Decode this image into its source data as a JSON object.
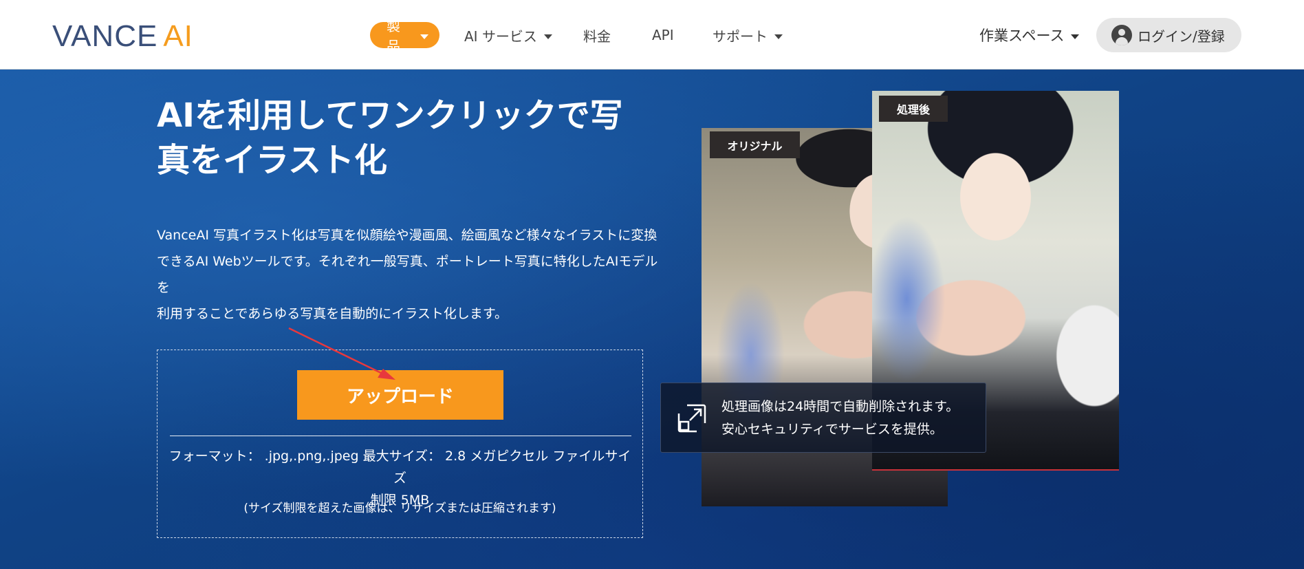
{
  "header": {
    "logo": {
      "part1": "VANCE",
      "part2": "AI"
    },
    "nav": [
      {
        "label": "製品",
        "has_dropdown": true,
        "active": true
      },
      {
        "label": "AI サービス",
        "has_dropdown": true
      },
      {
        "label": "料金",
        "has_dropdown": false
      },
      {
        "label": "API",
        "has_dropdown": false
      },
      {
        "label": "サポート",
        "has_dropdown": true
      }
    ],
    "workspace": "作業スペース",
    "login": "ログイン/登録"
  },
  "hero": {
    "headline_line1": "AIを利用してワンクリックで写",
    "headline_line2": "真をイラスト化",
    "description_line1": "VanceAI 写真イラスト化は写真を似顔絵や漫画風、絵画風など様々なイラストに変換",
    "description_line2": "できるAI Webツールです。それぞれ一般写真、ポートレート写真に特化したAIモデルを",
    "description_line3": "利用することであらゆる写真を自動的にイラスト化します。"
  },
  "upload": {
    "button": "アップロード",
    "format_line1": "フォーマット： .jpg,.png,.jpeg 最大サイズ： 2.8 メガピクセル ファイルサイズ",
    "format_line2": "制限 5MB",
    "note": "(サイズ制限を超えた画像は、リサイズまたは圧縮されます)"
  },
  "preview": {
    "original_label": "オリジナル",
    "processed_label": "処理後",
    "notice_line1": "処理画像は24時間で自動削除されます。",
    "notice_line2": "安心セキュリティでサービスを提供。"
  },
  "colors": {
    "accent": "#f8981d",
    "logo_dark": "#3a4f79",
    "hero_blue": "#104386",
    "arrow": "#e8383d"
  }
}
